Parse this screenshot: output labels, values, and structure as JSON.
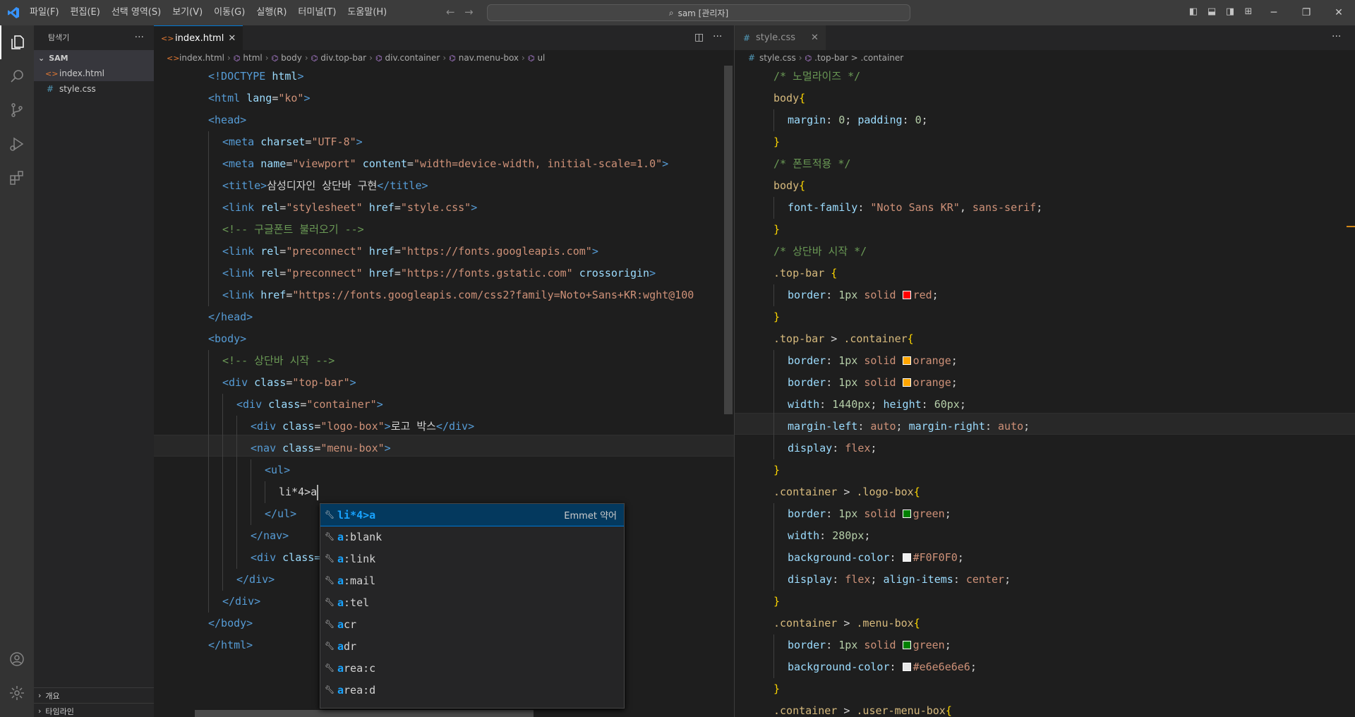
{
  "titlebar": {
    "menus": [
      "파일(F)",
      "편집(E)",
      "선택 영역(S)",
      "보기(V)",
      "이동(G)",
      "실행(R)",
      "터미널(T)",
      "도움말(H)"
    ],
    "search_text": "sam [관리자]"
  },
  "sidebar": {
    "title": "탐색기",
    "folder": "SAM",
    "files": [
      "index.html",
      "style.css"
    ],
    "bottom_sections": [
      "개요",
      "타임라인"
    ]
  },
  "left_editor": {
    "tab_label": "index.html",
    "breadcrumb": [
      "index.html",
      "html",
      "body",
      "div.top-bar",
      "div.container",
      "nav.menu-box",
      "ul"
    ],
    "current_line_text": "li*4>a"
  },
  "right_editor": {
    "tab_label": "style.css",
    "breadcrumb": [
      "style.css",
      ".top-bar > .container"
    ]
  },
  "html_lines": [
    {
      "indent": 0,
      "tokens": [
        [
          "t-tag",
          "<!DOCTYPE "
        ],
        [
          "t-attr",
          "html"
        ],
        [
          "t-tag",
          ">"
        ]
      ]
    },
    {
      "indent": 0,
      "tokens": [
        [
          "t-tag",
          "<html "
        ],
        [
          "t-attr",
          "lang"
        ],
        [
          "t-txt",
          "="
        ],
        [
          "t-str",
          "\"ko\""
        ],
        [
          "t-tag",
          ">"
        ]
      ]
    },
    {
      "indent": 0,
      "tokens": [
        [
          "t-tag",
          "<head>"
        ]
      ]
    },
    {
      "indent": 1,
      "tokens": [
        [
          "t-tag",
          "<meta "
        ],
        [
          "t-attr",
          "charset"
        ],
        [
          "t-txt",
          "="
        ],
        [
          "t-str",
          "\"UTF-8\""
        ],
        [
          "t-tag",
          ">"
        ]
      ]
    },
    {
      "indent": 1,
      "tokens": [
        [
          "t-tag",
          "<meta "
        ],
        [
          "t-attr",
          "name"
        ],
        [
          "t-txt",
          "="
        ],
        [
          "t-str",
          "\"viewport\" "
        ],
        [
          "t-attr",
          "content"
        ],
        [
          "t-txt",
          "="
        ],
        [
          "t-str",
          "\"width=device-width, initial-scale=1.0\""
        ],
        [
          "t-tag",
          ">"
        ]
      ]
    },
    {
      "indent": 1,
      "tokens": [
        [
          "t-tag",
          "<title>"
        ],
        [
          "t-txt",
          "삼성디자인 상단바 구현"
        ],
        [
          "t-tag",
          "</title>"
        ]
      ]
    },
    {
      "indent": 1,
      "tokens": [
        [
          "t-tag",
          "<link "
        ],
        [
          "t-attr",
          "rel"
        ],
        [
          "t-txt",
          "="
        ],
        [
          "t-str",
          "\"stylesheet\" "
        ],
        [
          "t-attr",
          "href"
        ],
        [
          "t-txt",
          "="
        ],
        [
          "t-str",
          "\"style.css\""
        ],
        [
          "t-tag",
          ">"
        ]
      ]
    },
    {
      "indent": 1,
      "tokens": [
        [
          "t-cmt",
          "<!-- 구글폰트 불러오기 -->"
        ]
      ]
    },
    {
      "indent": 1,
      "tokens": [
        [
          "t-tag",
          "<link "
        ],
        [
          "t-attr",
          "rel"
        ],
        [
          "t-txt",
          "="
        ],
        [
          "t-str",
          "\"preconnect\" "
        ],
        [
          "t-attr",
          "href"
        ],
        [
          "t-txt",
          "="
        ],
        [
          "t-str",
          "\"https://fonts.googleapis.com\""
        ],
        [
          "t-tag",
          ">"
        ]
      ]
    },
    {
      "indent": 1,
      "tokens": [
        [
          "t-tag",
          "<link "
        ],
        [
          "t-attr",
          "rel"
        ],
        [
          "t-txt",
          "="
        ],
        [
          "t-str",
          "\"preconnect\" "
        ],
        [
          "t-attr",
          "href"
        ],
        [
          "t-txt",
          "="
        ],
        [
          "t-str",
          "\"https://fonts.gstatic.com\" "
        ],
        [
          "t-attr",
          "crossorigin"
        ],
        [
          "t-tag",
          ">"
        ]
      ]
    },
    {
      "indent": 1,
      "tokens": [
        [
          "t-tag",
          "<link "
        ],
        [
          "t-attr",
          "href"
        ],
        [
          "t-txt",
          "="
        ],
        [
          "t-str",
          "\"https://fonts.googleapis.com/css2?family=Noto+Sans+KR:wght@100"
        ]
      ]
    },
    {
      "indent": 0,
      "tokens": [
        [
          "t-tag",
          "</head>"
        ]
      ]
    },
    {
      "indent": 0,
      "tokens": [
        [
          "t-tag",
          "<body>"
        ]
      ]
    },
    {
      "indent": 1,
      "tokens": [
        [
          "t-cmt",
          "<!-- 상단바 시작 -->"
        ]
      ]
    },
    {
      "indent": 1,
      "tokens": [
        [
          "t-tag",
          "<div "
        ],
        [
          "t-attr",
          "class"
        ],
        [
          "t-txt",
          "="
        ],
        [
          "t-str",
          "\"top-bar\""
        ],
        [
          "t-tag",
          ">"
        ]
      ]
    },
    {
      "indent": 2,
      "tokens": [
        [
          "t-tag",
          "<div "
        ],
        [
          "t-attr",
          "class"
        ],
        [
          "t-txt",
          "="
        ],
        [
          "t-str",
          "\"container\""
        ],
        [
          "t-tag",
          ">"
        ]
      ]
    },
    {
      "indent": 3,
      "tokens": [
        [
          "t-tag",
          "<div "
        ],
        [
          "t-attr",
          "class"
        ],
        [
          "t-txt",
          "="
        ],
        [
          "t-str",
          "\"logo-box\""
        ],
        [
          "t-tag",
          ">"
        ],
        [
          "t-txt",
          "로고 박스"
        ],
        [
          "t-tag",
          "</div>"
        ]
      ]
    },
    {
      "indent": 3,
      "tokens": [
        [
          "t-tag",
          "<nav "
        ],
        [
          "t-attr",
          "class"
        ],
        [
          "t-txt",
          "="
        ],
        [
          "t-str",
          "\"menu-box\""
        ],
        [
          "t-tag",
          ">"
        ]
      ]
    },
    {
      "indent": 4,
      "tokens": [
        [
          "t-tag",
          "<ul>"
        ]
      ]
    },
    {
      "indent": 5,
      "tokens": [
        [
          "t-txt",
          "li*4>a"
        ]
      ]
    },
    {
      "indent": 4,
      "tokens": [
        [
          "t-tag",
          "</ul>"
        ]
      ]
    },
    {
      "indent": 3,
      "tokens": [
        [
          "t-tag",
          "</nav>"
        ]
      ]
    },
    {
      "indent": 3,
      "tokens": [
        [
          "t-tag",
          "<div "
        ],
        [
          "t-attr",
          "class="
        ]
      ]
    },
    {
      "indent": 2,
      "tokens": [
        [
          "t-tag",
          "</div>"
        ]
      ]
    },
    {
      "indent": 1,
      "tokens": [
        [
          "t-tag",
          "</div>"
        ]
      ]
    },
    {
      "indent": 0,
      "tokens": [
        [
          "t-tag",
          "</body>"
        ]
      ]
    },
    {
      "indent": 0,
      "tokens": [
        [
          "t-tag",
          "</html>"
        ]
      ]
    }
  ],
  "css_lines": [
    {
      "indent": 0,
      "tokens": [
        [
          "t-cmt",
          "/* 노멀라이즈 */"
        ]
      ]
    },
    {
      "indent": 0,
      "tokens": [
        [
          "t-sel",
          "body"
        ],
        [
          "t-brace",
          "{"
        ]
      ]
    },
    {
      "indent": 1,
      "tokens": [
        [
          "t-prop",
          "margin"
        ],
        [
          "t-punc",
          ": "
        ],
        [
          "t-num",
          "0"
        ],
        [
          "t-punc",
          "; "
        ],
        [
          "t-prop",
          "padding"
        ],
        [
          "t-punc",
          ": "
        ],
        [
          "t-num",
          "0"
        ],
        [
          "t-punc",
          ";"
        ]
      ]
    },
    {
      "indent": 0,
      "tokens": [
        [
          "t-brace",
          "}"
        ]
      ]
    },
    {
      "indent": 0,
      "tokens": [
        [
          "t-cmt",
          "/* 폰트적용 */"
        ]
      ]
    },
    {
      "indent": 0,
      "tokens": [
        [
          "t-sel",
          "body"
        ],
        [
          "t-brace",
          "{"
        ]
      ]
    },
    {
      "indent": 1,
      "tokens": [
        [
          "t-prop",
          "font-family"
        ],
        [
          "t-punc",
          ": "
        ],
        [
          "t-val",
          "\"Noto Sans KR\""
        ],
        [
          "t-punc",
          ", "
        ],
        [
          "t-val",
          "sans-serif"
        ],
        [
          "t-punc",
          ";"
        ]
      ]
    },
    {
      "indent": 0,
      "tokens": [
        [
          "t-brace",
          "}"
        ]
      ]
    },
    {
      "indent": 0,
      "tokens": [
        [
          "t-cmt",
          "/* 상단바 시작 */"
        ]
      ]
    },
    {
      "indent": 0,
      "tokens": [
        [
          "t-sel",
          ".top-bar "
        ],
        [
          "t-brace",
          "{"
        ]
      ]
    },
    {
      "indent": 1,
      "tokens": [
        [
          "t-prop",
          "border"
        ],
        [
          "t-punc",
          ": "
        ],
        [
          "t-num",
          "1px "
        ],
        [
          "t-val",
          "solid "
        ],
        [
          "swatch",
          "#ff0000"
        ],
        [
          "t-val",
          "red"
        ],
        [
          "t-punc",
          ";"
        ]
      ]
    },
    {
      "indent": 0,
      "tokens": [
        [
          "t-brace",
          "}"
        ]
      ]
    },
    {
      "indent": 0,
      "tokens": [
        [
          "t-sel",
          ".top-bar "
        ],
        [
          "t-punc",
          "> "
        ],
        [
          "t-sel",
          ".container"
        ],
        [
          "t-brace",
          "{"
        ]
      ]
    },
    {
      "indent": 1,
      "tokens": [
        [
          "t-prop",
          "border"
        ],
        [
          "t-punc",
          ": "
        ],
        [
          "t-num",
          "1px "
        ],
        [
          "t-val",
          "solid "
        ],
        [
          "swatch",
          "#ffa500"
        ],
        [
          "t-val",
          "orange"
        ],
        [
          "t-punc",
          ";"
        ]
      ]
    },
    {
      "indent": 1,
      "tokens": [
        [
          "t-prop",
          "border"
        ],
        [
          "t-punc",
          ": "
        ],
        [
          "t-num",
          "1px "
        ],
        [
          "t-val",
          "solid "
        ],
        [
          "swatch",
          "#ffa500"
        ],
        [
          "t-val",
          "orange"
        ],
        [
          "t-punc",
          ";"
        ]
      ]
    },
    {
      "indent": 1,
      "tokens": [
        [
          "t-prop",
          "width"
        ],
        [
          "t-punc",
          ": "
        ],
        [
          "t-num",
          "1440px"
        ],
        [
          "t-punc",
          "; "
        ],
        [
          "t-prop",
          "height"
        ],
        [
          "t-punc",
          ": "
        ],
        [
          "t-num",
          "60px"
        ],
        [
          "t-punc",
          ";"
        ]
      ]
    },
    {
      "indent": 1,
      "tokens": [
        [
          "t-prop",
          "margin-left"
        ],
        [
          "t-punc",
          ": "
        ],
        [
          "t-val",
          "auto"
        ],
        [
          "t-punc",
          "; "
        ],
        [
          "t-prop",
          "margin-right"
        ],
        [
          "t-punc",
          ": "
        ],
        [
          "t-val",
          "auto"
        ],
        [
          "t-punc",
          ";"
        ]
      ]
    },
    {
      "indent": 1,
      "tokens": [
        [
          "t-prop",
          "display"
        ],
        [
          "t-punc",
          ": "
        ],
        [
          "t-val",
          "flex"
        ],
        [
          "t-punc",
          ";"
        ]
      ]
    },
    {
      "indent": 0,
      "tokens": [
        [
          "t-brace",
          "}"
        ]
      ]
    },
    {
      "indent": 0,
      "tokens": [
        [
          "t-sel",
          ".container "
        ],
        [
          "t-punc",
          "> "
        ],
        [
          "t-sel",
          ".logo-box"
        ],
        [
          "t-brace",
          "{"
        ]
      ]
    },
    {
      "indent": 1,
      "tokens": [
        [
          "t-prop",
          "border"
        ],
        [
          "t-punc",
          ": "
        ],
        [
          "t-num",
          "1px "
        ],
        [
          "t-val",
          "solid "
        ],
        [
          "swatch",
          "#008000"
        ],
        [
          "t-val",
          "green"
        ],
        [
          "t-punc",
          ";"
        ]
      ]
    },
    {
      "indent": 1,
      "tokens": [
        [
          "t-prop",
          "width"
        ],
        [
          "t-punc",
          ": "
        ],
        [
          "t-num",
          "280px"
        ],
        [
          "t-punc",
          ";"
        ]
      ]
    },
    {
      "indent": 1,
      "tokens": [
        [
          "t-prop",
          "background-color"
        ],
        [
          "t-punc",
          ": "
        ],
        [
          "swatch",
          "#F0F0F0"
        ],
        [
          "t-val",
          "#F0F0F0"
        ],
        [
          "t-punc",
          ";"
        ]
      ]
    },
    {
      "indent": 1,
      "tokens": [
        [
          "t-prop",
          "display"
        ],
        [
          "t-punc",
          ": "
        ],
        [
          "t-val",
          "flex"
        ],
        [
          "t-punc",
          "; "
        ],
        [
          "t-prop",
          "align-items"
        ],
        [
          "t-punc",
          ": "
        ],
        [
          "t-val",
          "center"
        ],
        [
          "t-punc",
          ";"
        ]
      ]
    },
    {
      "indent": 0,
      "tokens": [
        [
          "t-brace",
          "}"
        ]
      ]
    },
    {
      "indent": 0,
      "tokens": [
        [
          "t-sel",
          ".container "
        ],
        [
          "t-punc",
          "> "
        ],
        [
          "t-sel",
          ".menu-box"
        ],
        [
          "t-brace",
          "{"
        ]
      ]
    },
    {
      "indent": 1,
      "tokens": [
        [
          "t-prop",
          "border"
        ],
        [
          "t-punc",
          ": "
        ],
        [
          "t-num",
          "1px "
        ],
        [
          "t-val",
          "solid "
        ],
        [
          "swatch",
          "#008000"
        ],
        [
          "t-val",
          "green"
        ],
        [
          "t-punc",
          ";"
        ]
      ]
    },
    {
      "indent": 1,
      "tokens": [
        [
          "t-prop",
          "background-color"
        ],
        [
          "t-punc",
          ": "
        ],
        [
          "swatch",
          "#e6e6e6"
        ],
        [
          "t-val",
          "#e6e6e6e6"
        ],
        [
          "t-punc",
          ";"
        ]
      ]
    },
    {
      "indent": 0,
      "tokens": [
        [
          "t-brace",
          "}"
        ]
      ]
    },
    {
      "indent": 0,
      "tokens": [
        [
          "t-sel",
          ".container "
        ],
        [
          "t-punc",
          "> "
        ],
        [
          "t-sel",
          ".user-menu-box"
        ],
        [
          "t-brace",
          "{"
        ]
      ]
    }
  ],
  "suggestions": [
    {
      "hl": "li*4>a",
      "rest": "",
      "detail": "Emmet 약어"
    },
    {
      "hl": "a",
      "rest": ":blank"
    },
    {
      "hl": "a",
      "rest": ":link"
    },
    {
      "hl": "a",
      "rest": ":mail"
    },
    {
      "hl": "a",
      "rest": ":tel"
    },
    {
      "hl": "a",
      "rest": "cr"
    },
    {
      "hl": "a",
      "rest": "dr"
    },
    {
      "hl": "a",
      "rest": "rea:c"
    },
    {
      "hl": "a",
      "rest": "rea:d"
    }
  ]
}
